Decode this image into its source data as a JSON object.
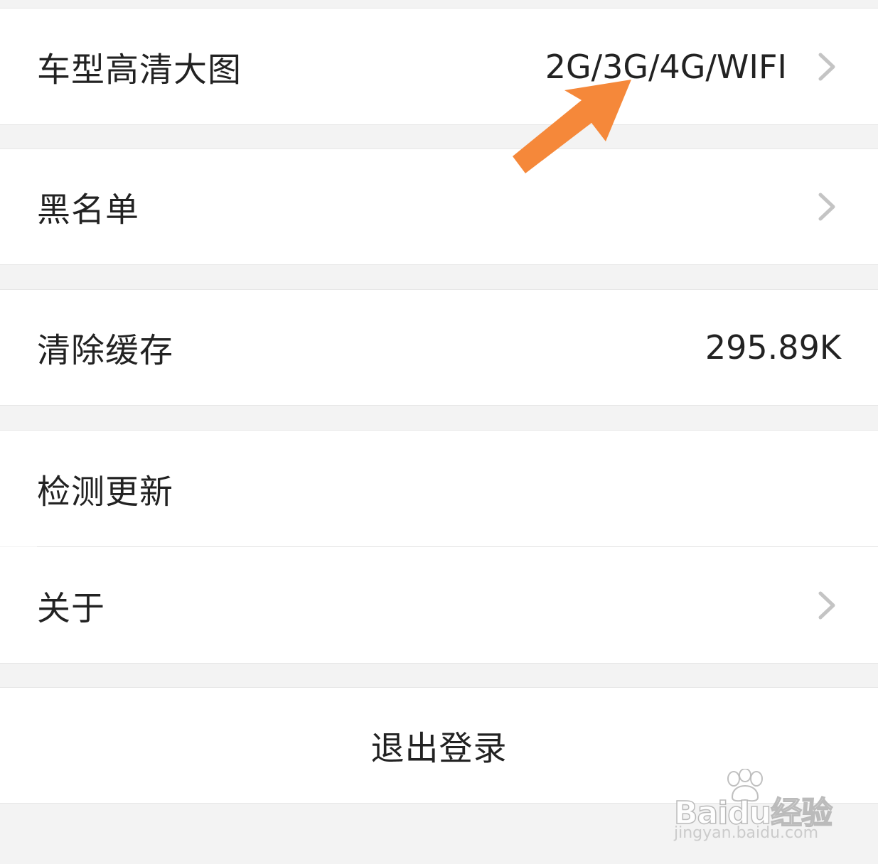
{
  "settings": {
    "rows": [
      {
        "label": "车型高清大图",
        "value": "2G/3G/4G/WIFI",
        "has_chevron": true
      },
      {
        "label": "黑名单",
        "value": "",
        "has_chevron": true
      },
      {
        "label": "清除缓存",
        "value": "295.89K",
        "has_chevron": false
      },
      {
        "label": "检测更新",
        "value": "",
        "has_chevron": false
      },
      {
        "label": "关于",
        "value": "",
        "has_chevron": true
      }
    ],
    "logout_label": "退出登录"
  },
  "annotation": {
    "arrow_color": "#f5883a"
  },
  "watermark": {
    "brand": "Baidu经验",
    "url": "jingyan.baidu.com"
  },
  "icons": {
    "chevron": "chevron-right-icon",
    "arrow": "arrow-annotation-icon",
    "paw": "baidu-paw-icon"
  }
}
